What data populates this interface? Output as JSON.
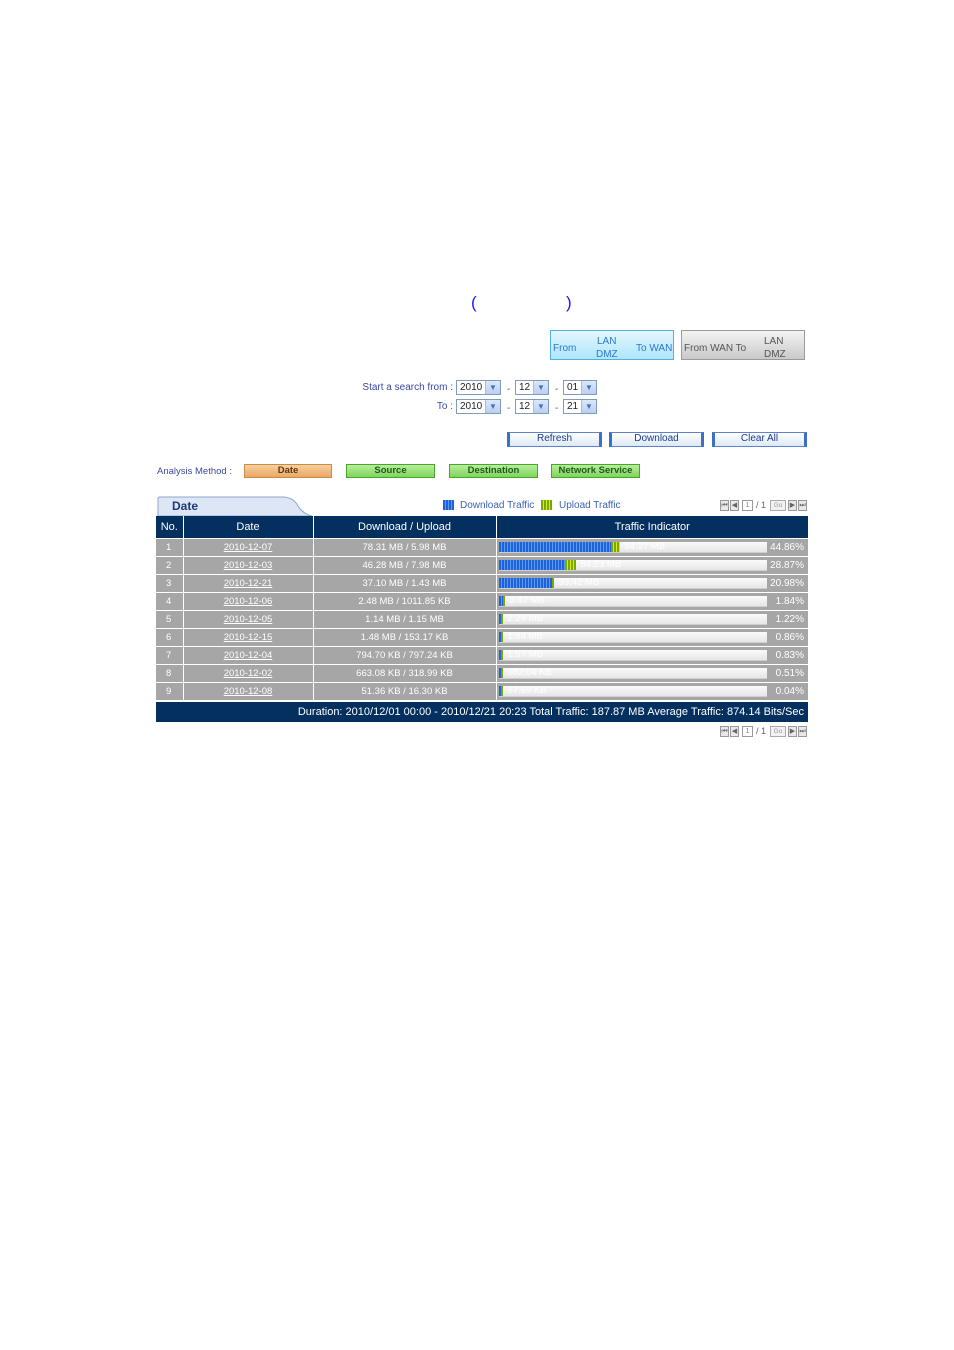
{
  "heading": {
    "open_paren": "(",
    "close_paren": ")"
  },
  "direction": {
    "active": {
      "from": "From",
      "mid_top": "LAN",
      "mid_bottom": "DMZ",
      "to": "To WAN"
    },
    "inactive": {
      "from": "From WAN To",
      "mid_top": "LAN",
      "mid_bottom": "DMZ"
    }
  },
  "search": {
    "start_label": "Start a search from :",
    "to_label": "To :",
    "separator": "-",
    "start": {
      "year": "2010",
      "month": "12",
      "day": "01"
    },
    "end": {
      "year": "2010",
      "month": "12",
      "day": "21"
    },
    "arrow": "▼"
  },
  "actions": {
    "refresh": "Refresh",
    "download": "Download",
    "clear_all": "Clear All"
  },
  "analysis": {
    "label": "Analysis Method :",
    "methods": [
      "Date",
      "Source",
      "Destination",
      "Network Service"
    ],
    "selected": "Date"
  },
  "tab": {
    "label": "Date"
  },
  "legend": {
    "download": {
      "label": "Download Traffic",
      "color": "#2060d8"
    },
    "upload": {
      "label": "Upload Traffic",
      "color": "#a8d000"
    }
  },
  "pager": {
    "first": "⏮",
    "prev": "◀",
    "current": "1",
    "sep": "/ 1",
    "go": "Go",
    "next": "▶",
    "last": "⏭"
  },
  "table": {
    "headers": [
      "No.",
      "Date",
      "Download / Upload",
      "Traffic Indicator"
    ],
    "rows": [
      {
        "no": "1",
        "date": "2010-12-07",
        "dlul": "78.31 MB / 5.98 MB",
        "total": "84.27 MB",
        "pct": "44.86%",
        "dl_frac": 0.4168,
        "ul_frac": 0.0318
      },
      {
        "no": "2",
        "date": "2010-12-03",
        "dlul": "46.28 MB / 7.98 MB",
        "total": "54.23 MB",
        "pct": "28.87%",
        "dl_frac": 0.2463,
        "ul_frac": 0.0425
      },
      {
        "no": "3",
        "date": "2010-12-21",
        "dlul": "37.10 MB / 1.43 MB",
        "total": "39.42 MB",
        "pct": "20.98%",
        "dl_frac": 0.1975,
        "ul_frac": 0.0076
      },
      {
        "no": "4",
        "date": "2010-12-06",
        "dlul": "2.48 MB / 1011.85 KB",
        "total": "3.47 MB",
        "pct": "1.84%",
        "dl_frac": 0.0132,
        "ul_frac": 0.0053
      },
      {
        "no": "5",
        "date": "2010-12-05",
        "dlul": "1.14 MB / 1.15 MB",
        "total": "2.29 MB",
        "pct": "1.22%",
        "dl_frac": 0.0061,
        "ul_frac": 0.0061
      },
      {
        "no": "6",
        "date": "2010-12-15",
        "dlul": "1.48 MB / 153.17 KB",
        "total": "1.64 MB",
        "pct": "0.86%",
        "dl_frac": 0.0079,
        "ul_frac": 0.0008
      },
      {
        "no": "7",
        "date": "2010-12-04",
        "dlul": "794.70 KB / 797.24 KB",
        "total": "1.57 MB",
        "pct": "0.83%",
        "dl_frac": 0.0041,
        "ul_frac": 0.0042
      },
      {
        "no": "8",
        "date": "2010-12-02",
        "dlul": "663.08 KB / 318.99 KB",
        "total": "982.04 KB",
        "pct": "0.51%",
        "dl_frac": 0.0034,
        "ul_frac": 0.0017
      },
      {
        "no": "9",
        "date": "2010-12-08",
        "dlul": "51.36 KB / 16.30 KB",
        "total": "67.65 KB",
        "pct": "0.04%",
        "dl_frac": 0.0003,
        "ul_frac": 0.0001
      }
    ]
  },
  "footer": {
    "text": "Duration: 2010/12/01 00:00 - 2010/12/21 20:23   Total Traffic: 187.87 MB   Average Traffic: 874.14 Bits/Sec"
  }
}
